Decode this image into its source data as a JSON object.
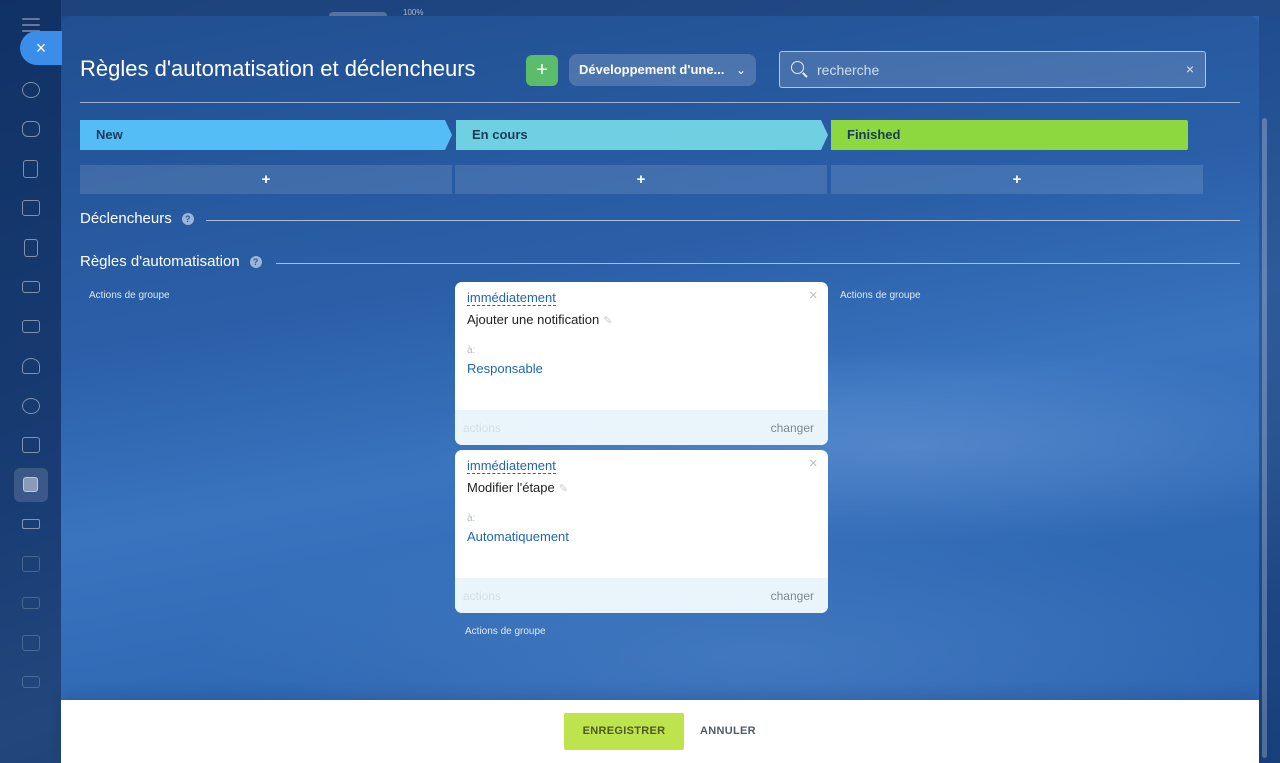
{
  "behind": {
    "zoom_text": "100%"
  },
  "page": {
    "title": "Règles d'automatisation et déclencheurs",
    "add_label": "+",
    "category_label": "Développement d'une...",
    "search_placeholder": "recherche",
    "search_value": "",
    "search_clear": "×",
    "close_label": "×"
  },
  "stages": [
    {
      "label": "New",
      "color": "#55bdf5"
    },
    {
      "label": "En cours",
      "color": "#6fd0e2"
    },
    {
      "label": "Finished",
      "color": "#8ed83f"
    }
  ],
  "stage_add_label": "+",
  "sections": {
    "triggers": "Déclencheurs",
    "rules": "Règles d'automatisation",
    "help": "?"
  },
  "group_actions": "Actions de groupe",
  "rules": [
    {
      "timing": "immédiatement",
      "title": "Ajouter une notification",
      "to_label": "à:",
      "to_value": "Responsable",
      "footer_left": "actions",
      "footer_right": "changer"
    },
    {
      "timing": "immédiatement",
      "title": "Modifier l'étape",
      "to_label": "à:",
      "to_value": "Automatiquement",
      "footer_left": "actions",
      "footer_right": "changer"
    }
  ],
  "buttons": {
    "save": "ENREGISTRER",
    "cancel": "ANNULER"
  },
  "sidebar_icons": [
    "activity-icon",
    "chat-icon",
    "feed-icon",
    "calendar-icon",
    "document-icon",
    "drive-icon",
    "mail-icon",
    "contacts-icon",
    "crm-icon",
    "sites-icon",
    "tasks-icon",
    "filter-icon",
    "box-icon",
    "cart-icon",
    "terminal-icon",
    "robot-icon"
  ]
}
